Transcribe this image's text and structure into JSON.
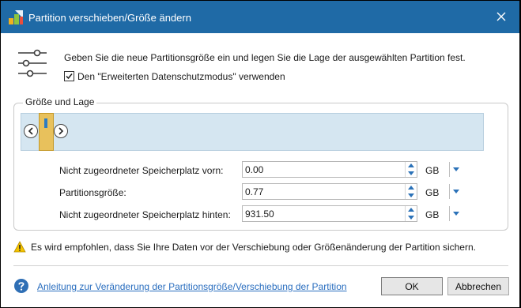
{
  "window": {
    "title": "Partition verschieben/Größe ändern",
    "accent": "#1f6aa6"
  },
  "intro": {
    "description": "Geben Sie die neue Partitionsgröße ein und legen Sie die Lage der ausgewählten Partition fest.",
    "checkbox_label": "Den \"Erweiterten Datenschutzmodus\" verwenden",
    "checkbox_checked": true
  },
  "group": {
    "legend": "Größe und Lage",
    "track_color": "#d5e6f1",
    "partition_color": "#e8c15c"
  },
  "fields": [
    {
      "label": "Nicht zugeordneter Speicherplatz vorn:",
      "value": "0.00",
      "unit": "GB"
    },
    {
      "label": "Partitionsgröße:",
      "value": "0.77",
      "unit": "GB"
    },
    {
      "label": "Nicht zugeordneter Speicherplatz hinten:",
      "value": "931.50",
      "unit": "GB"
    }
  ],
  "warning": {
    "text": "Es wird empfohlen, dass Sie Ihre Daten vor der Verschiebung oder Größenänderung der Partition sichern."
  },
  "footer": {
    "help_link": "Anleitung zur Veränderung der Partitionsgröße/Verschiebung der Partition",
    "ok_label": "OK",
    "cancel_label": "Abbrechen"
  },
  "icons": {
    "app": "app-logo-icon",
    "close": "close-icon",
    "sliders": "sliders-icon",
    "check": "checkmark-icon",
    "warning": "warning-icon",
    "help": "help-icon"
  }
}
